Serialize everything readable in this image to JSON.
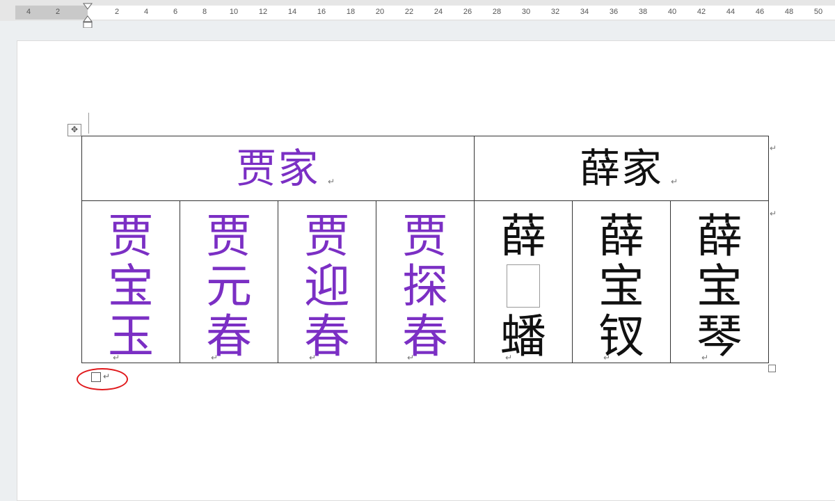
{
  "ruler": {
    "left_labels": [
      "4",
      "2"
    ],
    "labels": [
      "2",
      "4",
      "6",
      "8",
      "10",
      "12",
      "14",
      "16",
      "18",
      "20",
      "22",
      "24",
      "26",
      "28",
      "30",
      "32",
      "34",
      "36",
      "38",
      "40",
      "42",
      "44",
      "46",
      "48",
      "50"
    ]
  },
  "table": {
    "header": {
      "jia": "贾家",
      "xue": "薛家"
    },
    "cells": [
      {
        "text": "贾宝玉",
        "color": "#7b2fc4"
      },
      {
        "text": "贾元春",
        "color": "#7b2fc4"
      },
      {
        "text": "贾迎春",
        "color": "#7b2fc4"
      },
      {
        "text": "贾探春",
        "color": "#7b2fc4"
      },
      {
        "top": "薛",
        "bottom": "蟠",
        "missing_glyph": true,
        "color": "#111111"
      },
      {
        "text": "薛宝钗",
        "color": "#111111"
      },
      {
        "text": "薛宝琴",
        "color": "#111111"
      }
    ],
    "para_mark": "↵"
  },
  "colors": {
    "highlight": "#e0191c",
    "purple": "#7b2fc4"
  }
}
